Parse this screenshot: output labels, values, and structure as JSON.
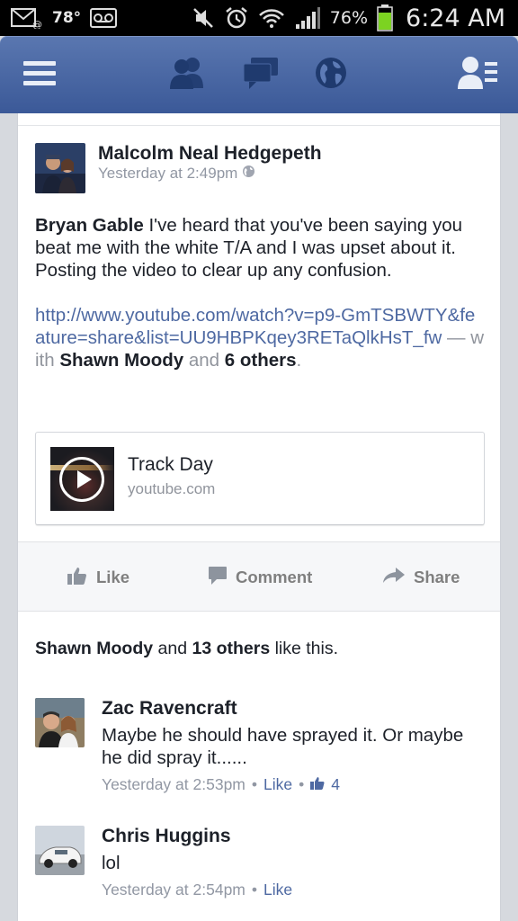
{
  "status_bar": {
    "temperature": "78°",
    "battery_percent": "76%",
    "time": "6:24 AM",
    "icons": [
      "email-icon",
      "voicemail-icon",
      "mute-icon",
      "alarm-icon",
      "wifi-icon",
      "signal-icon",
      "battery-icon"
    ]
  },
  "nav": {
    "icons": [
      "menu-icon",
      "friend-requests-icon",
      "messages-icon",
      "notifications-globe-icon",
      "online-friends-icon"
    ],
    "brand_color": "#3b5998"
  },
  "post": {
    "author": "Malcolm Neal Hedgepeth",
    "timestamp": "Yesterday at 2:49pm",
    "mention": "Bryan Gable",
    "text": " I've heard that you've been saying you beat me with the white T/A and I was upset about it. Posting the video to clear up any confusion.",
    "url": "http://www.youtube.com/watch?v=p9-GmTSBWTY&feature=share&list=UU9HBPKqey3RETaQlkHsT_fw",
    "with_text": " — with ",
    "tagged_person": "Shawn Moody",
    "and_text": " and ",
    "others_count": "6 others",
    "period": ".",
    "shared_link": {
      "title": "Track Day",
      "domain": "youtube.com"
    }
  },
  "actions": {
    "like": "Like",
    "comment": "Comment",
    "share": "Share"
  },
  "likes_summary": {
    "name": "Shawn Moody",
    "and": " and ",
    "others": "13 others",
    "suffix": " like this."
  },
  "comments": [
    {
      "name": "Zac Ravencraft",
      "text": "Maybe he should have sprayed it. Or maybe he did spray it......",
      "timestamp": "Yesterday at 2:53pm",
      "like_label": "Like",
      "like_count": "4"
    },
    {
      "name": "Chris Huggins",
      "text": "lol",
      "timestamp": "Yesterday at 2:54pm",
      "like_label": "Like"
    }
  ]
}
